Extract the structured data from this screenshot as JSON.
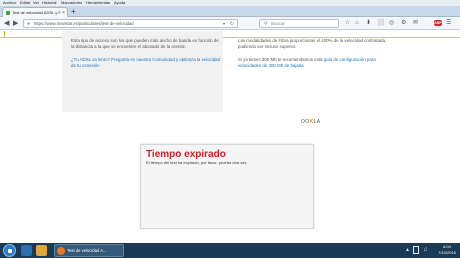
{
  "menu": [
    "Archivo",
    "Editar",
    "Ver",
    "Historial",
    "Marcadores",
    "Herramientas",
    "Ayuda"
  ],
  "tab": {
    "title": "Test de velocidad ADSL y F...",
    "close": "×",
    "new_tab": "+"
  },
  "nav": {
    "back": "◀",
    "forward": "▶",
    "url": "https://www.movistar.es/particulares/test-de-velocidad",
    "url_dropdown": "▾",
    "reload": "↻",
    "search_placeholder": "Buscar",
    "icons": [
      "☆",
      "⌂",
      "⬇",
      "⬜",
      "◎",
      "⚙",
      "✉"
    ],
    "abp_label": "ABP"
  },
  "page": {
    "left_text": "Esta tipo de acceso son los que pueden más ancho de banda en función de la distancia a la que se encuentre el abonado de la central.",
    "left_link": "¿Tu ADSL va lento? Pregunta en nuestra Comunidad y optimiza la velocidad de tu conexión",
    "right_text": "Las modalidades de Fibra proporcionan el 100% de la velocidad contratada, pudiendo ser incluso superior.",
    "right_para_prefix": "Si ya tienes 300 Mb te recomendamos esta ",
    "right_para_link": "guía de configuración para velocidades de 300 Mb de bajada",
    "ookla_prefix": "OO",
    "ookla_k": "K",
    "ookla_suffix": "LA",
    "result_title": "Tiempo expirado",
    "result_message": "El tiempo del test ha expirado, por favor, prueba otra vez."
  },
  "taskbar": {
    "task_label": "Test de velocidad A...",
    "time": "8:04",
    "date": "7/10/2016"
  },
  "colors": {
    "accent_red": "#cf2027",
    "link_blue": "#1a73b8",
    "header_line": "#c7d82e",
    "taskbar": "#1b3a56"
  }
}
